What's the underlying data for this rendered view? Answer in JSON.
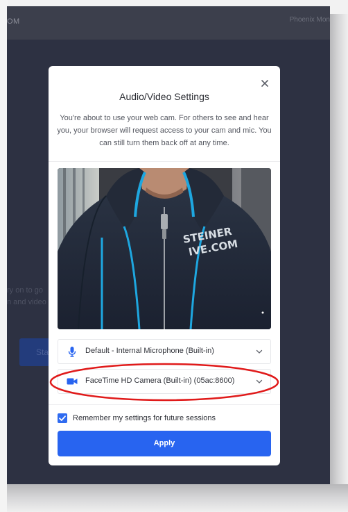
{
  "app": {
    "brand": "OM",
    "nav_user": "Phoenix Mon"
  },
  "background": {
    "text_line_1": "ry on to go",
    "text_line_2": "n and video",
    "button_label": "Sta"
  },
  "modal": {
    "title": "Audio/Video Settings",
    "description": "You're about to use your web cam. For others to see and hear you, your browser will request access to your cam and mic. You can still turn them back off at any time.",
    "close_icon": "close-icon",
    "microphone": {
      "icon": "microphone-icon",
      "selected": "Default - Internal Microphone (Built-in)"
    },
    "camera": {
      "icon": "video-camera-icon",
      "selected": "FaceTime HD Camera (Built-in) (05ac:8600)"
    },
    "remember": {
      "label": "Remember my settings for future sessions",
      "checked": true
    },
    "apply_label": "Apply",
    "preview": {
      "hoodie_text_line_1": "STEINER",
      "hoodie_text_line_2": "IVE.COM"
    }
  },
  "colors": {
    "accent": "#2864f0",
    "highlight": "#e01a1a",
    "app_background": "#2d3142",
    "hoodie_trim": "#1ea7e0"
  }
}
